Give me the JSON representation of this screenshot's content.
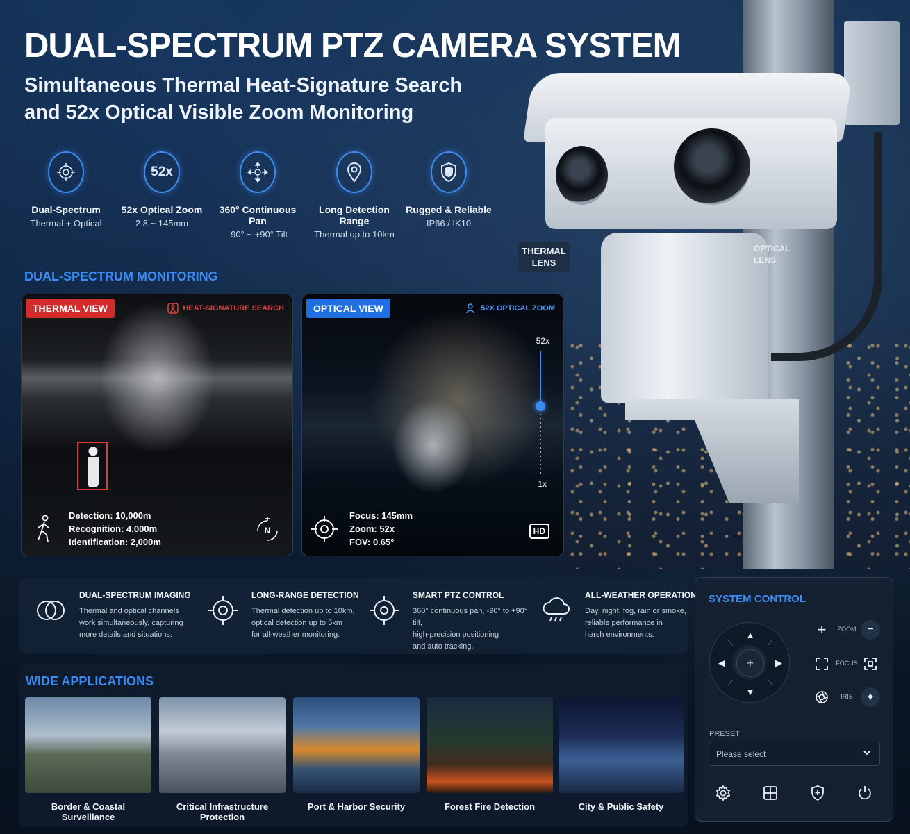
{
  "header": {
    "title": "DUAL-SPECTRUM PTZ CAMERA SYSTEM",
    "subtitle_line1": "Simultaneous Thermal Heat-Signature Search",
    "subtitle_line2": "and 52x Optical Visible Zoom Monitoring"
  },
  "features": [
    {
      "icon": "crosshair-icon",
      "title": "Dual-Spectrum",
      "sub": "Thermal + Optical"
    },
    {
      "icon": "zoom-52x-icon",
      "icon_text": "52x",
      "title": "52x Optical Zoom",
      "sub": "2.8 ~ 145mm"
    },
    {
      "icon": "pan-arrows-icon",
      "title": "360° Continuous Pan",
      "sub": "-90° ~ +90° Tilt"
    },
    {
      "icon": "location-pin-icon",
      "title": "Long Detection Range",
      "sub": "Thermal up to 10km"
    },
    {
      "icon": "shield-icon",
      "title": "Rugged & Reliable",
      "sub": "IP66 / IK10"
    }
  ],
  "camera": {
    "thermal_lens_line1": "THERMAL",
    "thermal_lens_line2": "LENS",
    "optical_lens_line1": "OPTICAL",
    "optical_lens_line2": "LENS"
  },
  "monitoring": {
    "section_label": "DUAL-SPECTRUM MONITORING",
    "thermal": {
      "tag": "THERMAL VIEW",
      "badge": "HEAT-SIGNATURE SEARCH",
      "detection": "Detection: 10,000m",
      "recognition": "Recognition: 4,000m",
      "identification": "Identification: 2,000m",
      "compass": "N"
    },
    "optical": {
      "tag": "OPTICAL VIEW",
      "badge": "52X OPTICAL ZOOM",
      "zoom_max": "52x",
      "zoom_min": "1x",
      "zoom_level": 0.55,
      "focus": "Focus: 145mm",
      "zoom": "Zoom: 52x",
      "fov": "FOV: 0.65°",
      "hd": "HD"
    }
  },
  "info": [
    {
      "icon": "dual-circles-icon",
      "title": "DUAL-SPECTRUM IMAGING",
      "line1": "Thermal and optical channels",
      "line2": "work simultaneously, capturing",
      "line3": "more details and situations."
    },
    {
      "icon": "target-icon",
      "title": "LONG-RANGE DETECTION",
      "line1": "Thermal detection up to 10km,",
      "line2": "optical detection up to 5km",
      "line3": "for all-weather monitoring."
    },
    {
      "icon": "ptz-target-icon",
      "title": "SMART PTZ CONTROL",
      "line1": "360° continuous pan, -90° to +90° tilt,",
      "line2": "high-precision positioning",
      "line3": "and auto tracking."
    },
    {
      "icon": "cloud-rain-icon",
      "title": "ALL-WEATHER OPERATION",
      "line1": "Day, night, fog, rain or smoke,",
      "line2": "reliable performance in",
      "line3": "harsh environments."
    }
  ],
  "applications": {
    "section_label": "WIDE APPLICATIONS",
    "items": [
      {
        "label": "Border & Coastal Surveillance"
      },
      {
        "label": "Critical Infrastructure Protection"
      },
      {
        "label": "Port & Harbor Security"
      },
      {
        "label": "Forest Fire Detection"
      },
      {
        "label": "City & Public Safety"
      }
    ]
  },
  "system_control": {
    "title": "SYSTEM CONTROL",
    "zoom_label": "ZOOM",
    "focus_label": "FOCUS",
    "iris_label": "IRIS",
    "preset_label": "PRESET",
    "preset_placeholder": "Please select"
  },
  "colors": {
    "accent": "#3b8cf5",
    "thermal_tag": "#d22c2c",
    "optical_tag": "#1f6fe0"
  }
}
